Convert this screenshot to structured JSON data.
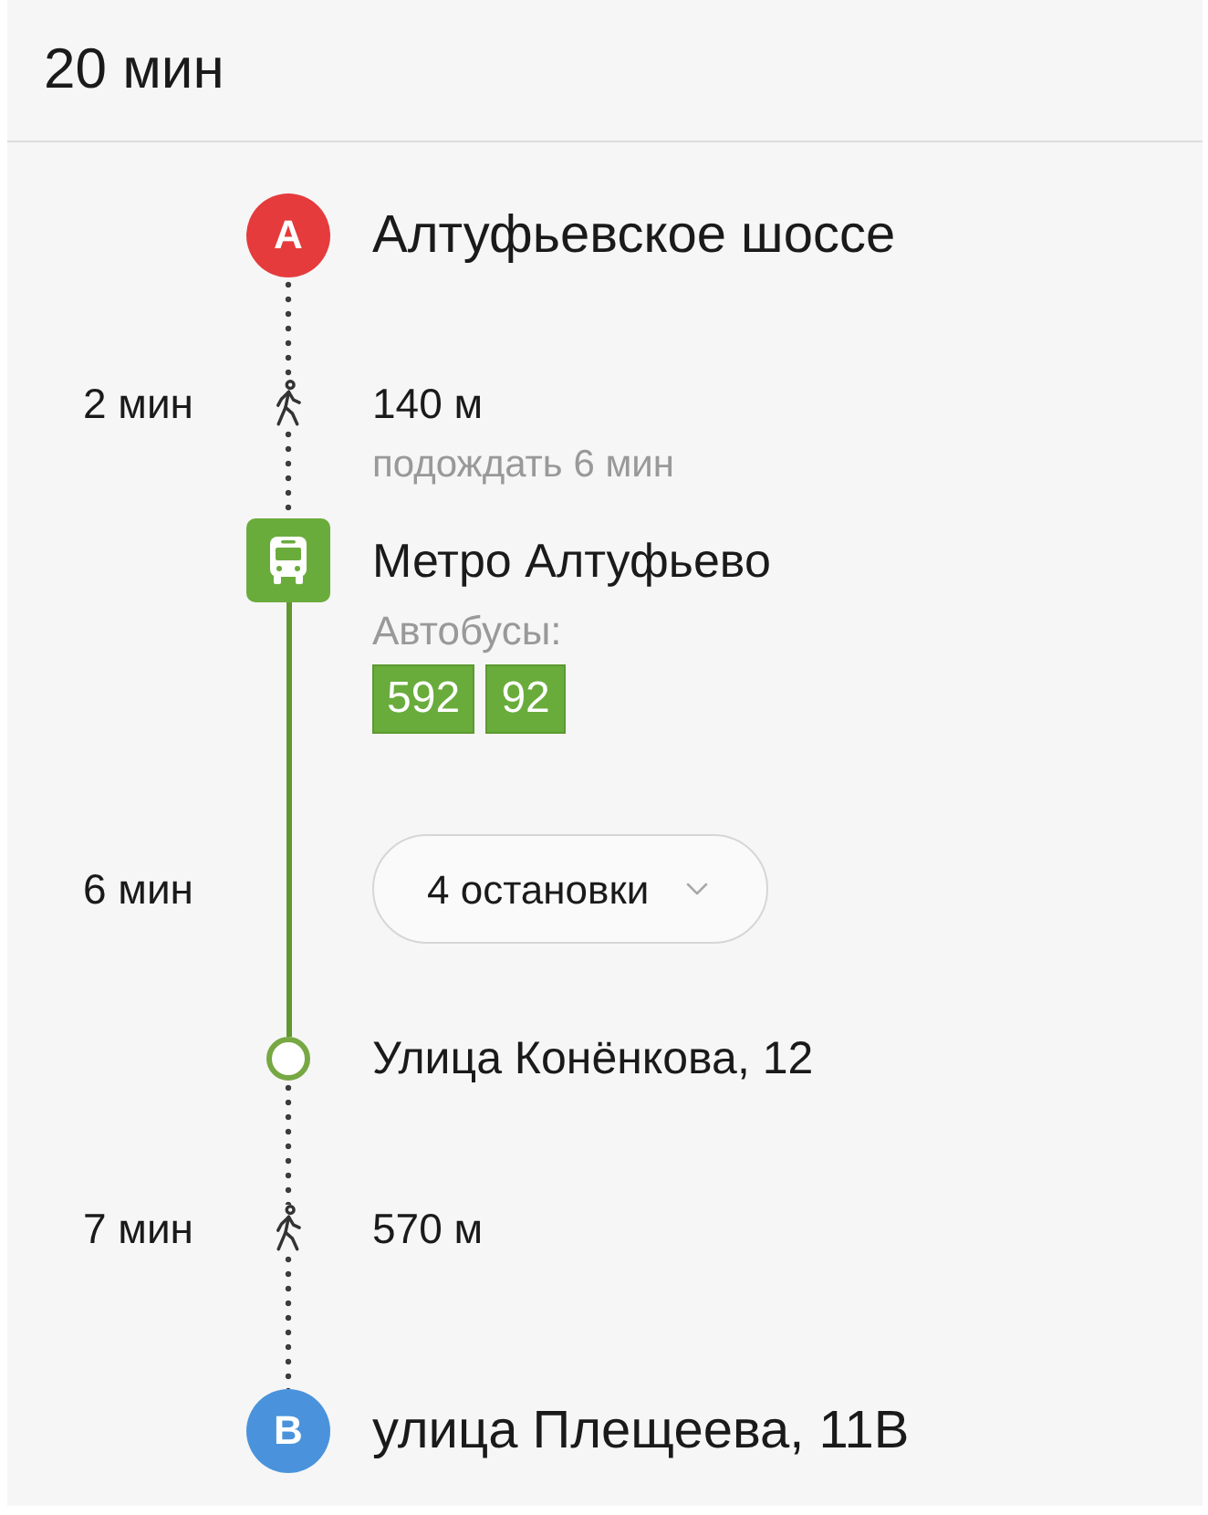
{
  "header": {
    "duration": "20 мин"
  },
  "steps": [
    {
      "kind": "point",
      "marker": {
        "letter": "A",
        "color": "#e53b3d"
      },
      "title": "Алтуфьевское шоссе"
    },
    {
      "kind": "walk",
      "time": "2 мин",
      "distance": "140 м",
      "note": "подождать 6 мин"
    },
    {
      "kind": "stop",
      "title": "Метро Алтуфьево",
      "routes_label": "Автобусы:",
      "routes": [
        "592",
        "92"
      ]
    },
    {
      "kind": "ride",
      "time": "6 мин",
      "stops_button": {
        "label": "4 остановки",
        "expanded": false
      }
    },
    {
      "kind": "exit",
      "title": "Улица Конёнкова, 12"
    },
    {
      "kind": "walk",
      "time": "7 мин",
      "distance": "570 м"
    },
    {
      "kind": "point",
      "marker": {
        "letter": "B",
        "color": "#4a93dc"
      },
      "title": "улица Плещеева, 11В"
    }
  ]
}
